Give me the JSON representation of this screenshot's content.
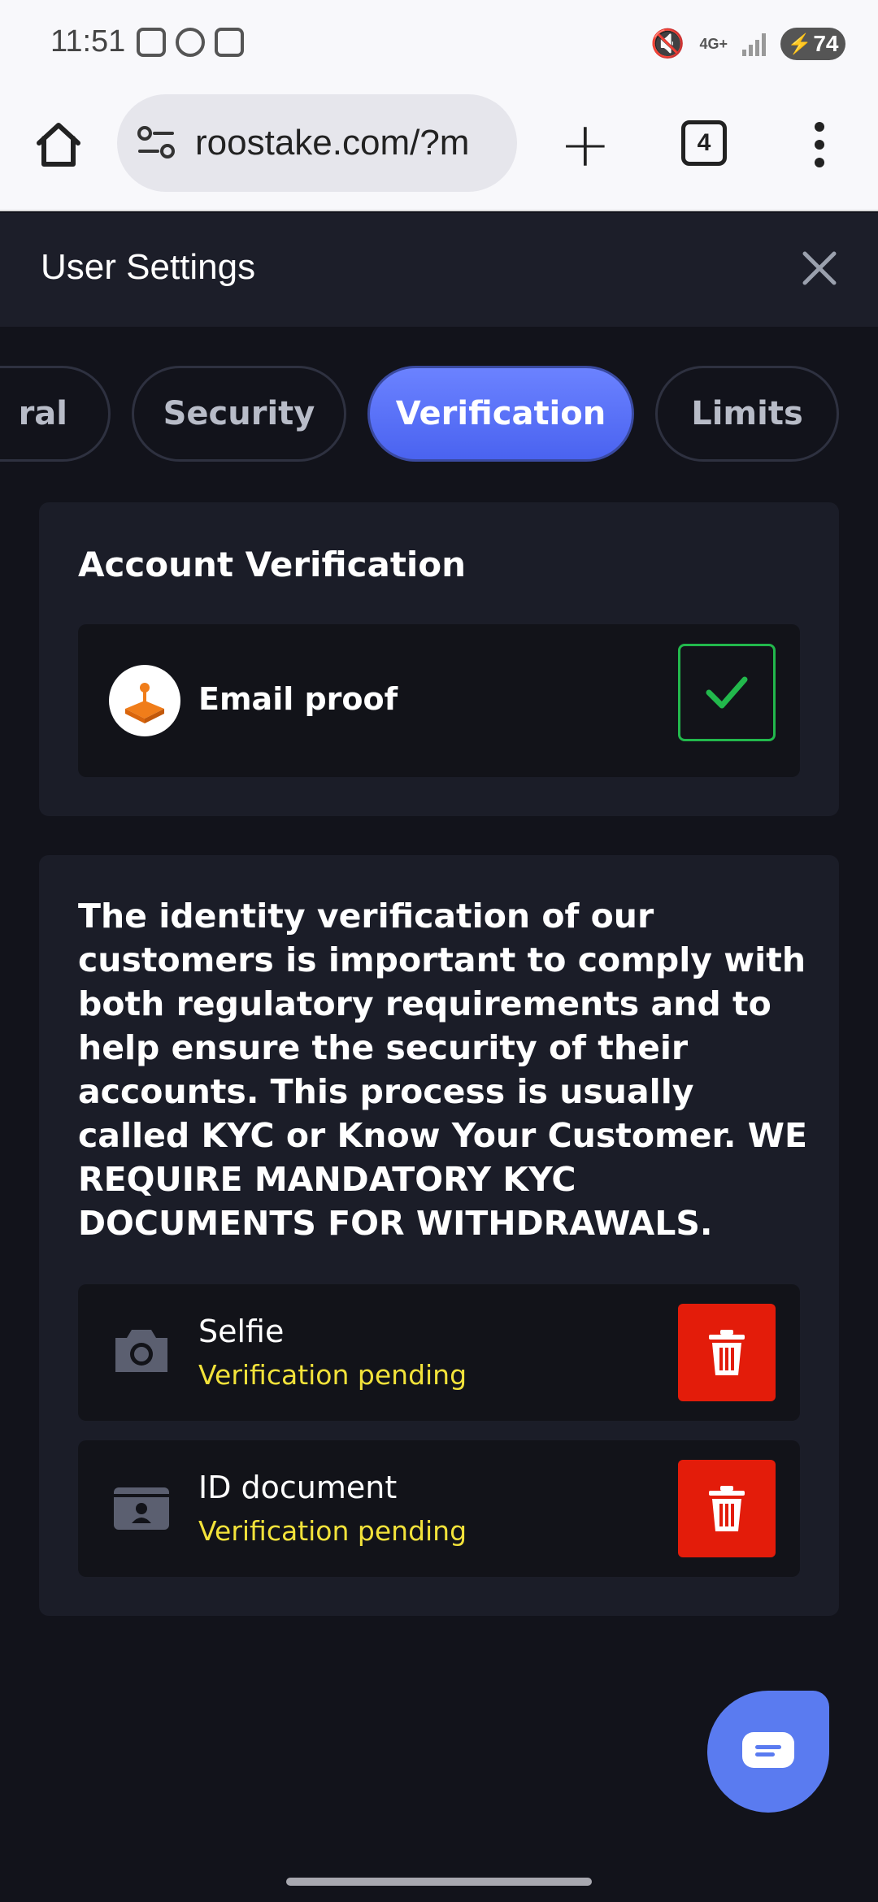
{
  "status_bar": {
    "time": "11:51",
    "network": "4G+",
    "battery": "74"
  },
  "browser": {
    "url": "roostake.com/?m",
    "tab_count": "4"
  },
  "settings": {
    "title": "User Settings"
  },
  "tabs": [
    {
      "label": "ral",
      "active": false
    },
    {
      "label": "Security",
      "active": false
    },
    {
      "label": "Verification",
      "active": true
    },
    {
      "label": "Limits",
      "active": false
    }
  ],
  "account_verification": {
    "title": "Account Verification",
    "email_proof_label": "Email proof",
    "email_verified": true
  },
  "kyc": {
    "description": "The identity verification of our customers is important to comply with both regulatory requirements and to help ensure the security of their accounts. This process is usually called KYC or Know Your Customer. WE REQUIRE MANDATORY KYC DOCUMENTS FOR WITHDRAWALS.",
    "documents": [
      {
        "title": "Selfie",
        "status": "Verification pending",
        "icon": "camera-icon"
      },
      {
        "title": "ID document",
        "status": "Verification pending",
        "icon": "id-card-icon"
      }
    ]
  },
  "colors": {
    "accent": "#5a7bf0",
    "success": "#22b84c",
    "pending": "#f2e23a",
    "danger": "#e31c0a",
    "brand_orange": "#f07d1a"
  }
}
